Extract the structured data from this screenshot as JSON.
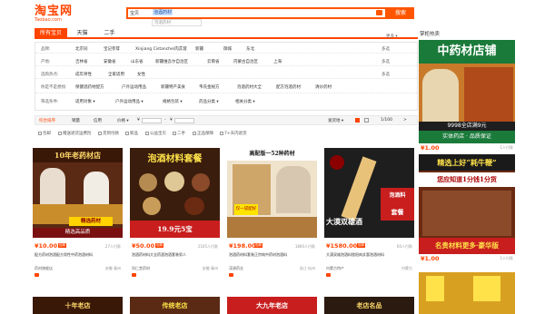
{
  "header": {
    "logo": "淘宝网",
    "logo_sub": "Taobao.com",
    "search_type": "宝贝",
    "search_query": "泡酒药材",
    "suggestion": "泡酒药材",
    "search_button": "搜索"
  },
  "tabs": [
    {
      "label": "所有宝贝",
      "active": true
    },
    {
      "label": "天猫",
      "active": false
    },
    {
      "label": "二手",
      "active": false
    }
  ],
  "right_title": "掌柜热卖",
  "filters": {
    "rows": [
      {
        "label": "品牌:",
        "items": [
          "北京同",
          "宝记参茸",
          "Xinjiang Cistanche/肉苁蓉",
          "新疆",
          "御城",
          "东北"
        ],
        "more": "多选"
      },
      {
        "label": "产地:",
        "items": [
          "吉林省",
          "安徽省",
          "山东省",
          "新疆维吾尔自治区",
          "云南省",
          "内蒙古自治区",
          "上海"
        ],
        "more": "多选"
      },
      {
        "label": "选购热点:",
        "items": [
          "成年男性",
          "全家适用",
          "女性"
        ],
        "more": "多选"
      },
      {
        "label": "你是不是想找:",
        "items": [
          "保健酒药材配方",
          "户外运动用品",
          "新疆特产美食",
          "韦氏金秘方",
          "泡酒药材大全",
          "配方泡酒药材",
          "清炒药材"
        ],
        "more": ""
      },
      {
        "label": "筛选条件:",
        "items": [
          "适用对象 ▾",
          "户外运动用品 ▾",
          "规格包装 ▾",
          "药品分类 ▾",
          "相关分类 ▾"
        ],
        "more": ""
      }
    ],
    "more_right": "更多 ▾"
  },
  "sortbar": {
    "items": [
      "综合排序",
      "销量",
      "信用",
      "价格 ▾",
      "¥",
      "-",
      "¥"
    ],
    "right": [
      "发货地 ▾",
      "1/100"
    ],
    "next": ">"
  },
  "options": [
    "包邮",
    "赠送退货运费险",
    "货到付款",
    "新品",
    "公益宝贝",
    "二手",
    "正品保障",
    "7+天内退货"
  ],
  "products": [
    {
      "price": "10.00",
      "tag": "包邮",
      "sales": "27人付款",
      "title": "配方药材泡酒配方男性中药泡酒材料",
      "shop": "药材旗舰店",
      "loc": "安徽 亳州",
      "banner": "10年老药材店",
      "subbanner": "精选药材",
      "bottom": "精选高品质",
      "bg": "#5b2a14"
    },
    {
      "price": "50.00",
      "tag": "包邮",
      "sales": "2165人付款",
      "title": "泡酒药材料大全药酒泡酒套装男人",
      "shop": "同仁堂药材",
      "loc": "安徽 亳州",
      "banner": "泡酒材料套餐",
      "subbanner": "19.9元5宝",
      "bottom": "",
      "bg": "#3a1d0c"
    },
    {
      "price": "198.00",
      "tag": "包邮",
      "sales": "1860人付款",
      "title": "泡酒药材料套装正宗纯中药材泡酒料",
      "shop": "茂源药业",
      "loc": "浙江 杭州",
      "banner": "高配版一52种药材",
      "subbanner": "仅一袋配好",
      "bottom": "",
      "bg": "#d8b07a"
    },
    {
      "price": "1580.00",
      "tag": "包邮",
      "sales": "60人付款",
      "title": "大漠双雄泡酒料锁阳肉苁蓉泡酒材料",
      "shop": "内蒙古特产",
      "loc": "内蒙古",
      "banner": "泡酒料",
      "subbanner": "大漠双雄酒",
      "bottom": "套餐",
      "bg": "#1e1e1e"
    }
  ],
  "side_items": [
    {
      "title": "中药材店铺",
      "sub": "9998全店满9元",
      "tagline": "实体药店 · 品质保证",
      "price": "1.00",
      "sales": "1人付款"
    },
    {
      "title": "精选上好“耗牛鞭”",
      "sub": "您应知道1分钱1分货",
      "tagline": "名贵材料更多·豪华版",
      "price": "1.00",
      "sales": "1人付款"
    }
  ],
  "bottom_row": [
    "十年老店",
    "传统老店",
    "大九年老店",
    "老店名品"
  ],
  "colors": {
    "accent": "#ff4400",
    "brand": "#ff5500"
  }
}
